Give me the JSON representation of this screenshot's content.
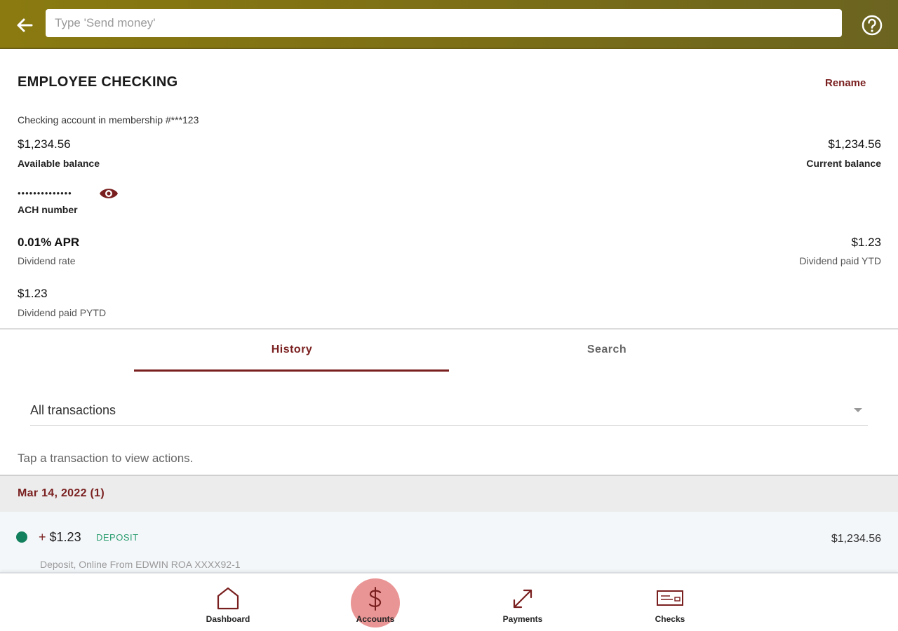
{
  "search": {
    "placeholder": "Type 'Send money'"
  },
  "account": {
    "title": "EMPLOYEE CHECKING",
    "rename_label": "Rename",
    "subtitle": "Checking account in membership #***123",
    "available_balance": {
      "value": "$1,234.56",
      "label": "Available balance"
    },
    "current_balance": {
      "value": "$1,234.56",
      "label": "Current balance"
    },
    "ach": {
      "masked": "••••••••••••••",
      "label": "ACH number"
    },
    "dividend_rate": {
      "value": "0.01% APR",
      "label": "Dividend rate"
    },
    "dividend_ytd": {
      "value": "$1.23",
      "label": "Dividend paid YTD"
    },
    "dividend_pytd": {
      "value": "$1.23",
      "label": "Dividend paid PYTD"
    }
  },
  "tabs": [
    {
      "label": "History",
      "active": true
    },
    {
      "label": "Search",
      "active": false
    }
  ],
  "filter": {
    "selected": "All transactions"
  },
  "hint": "Tap a transaction to view actions.",
  "groups": [
    {
      "date": "Mar 14, 2022 (1)",
      "transactions": [
        {
          "sign": "+",
          "amount": "$1.23",
          "type": "DEPOSIT",
          "balance": "$1,234.56",
          "description": "Deposit, Online From EDWIN ROA XXXX92-1"
        }
      ]
    }
  ],
  "nav": [
    {
      "label": "Dashboard",
      "icon": "home-icon",
      "active": false
    },
    {
      "label": "Accounts",
      "icon": "dollar-icon",
      "active": true
    },
    {
      "label": "Payments",
      "icon": "transfer-arrows-icon",
      "active": false
    },
    {
      "label": "Checks",
      "icon": "check-icon",
      "active": false
    }
  ],
  "colors": {
    "appbar": "#7d6f16",
    "accent": "#7a1f1f",
    "deposit": "#12805c",
    "active_nav": "#e88a8a"
  }
}
